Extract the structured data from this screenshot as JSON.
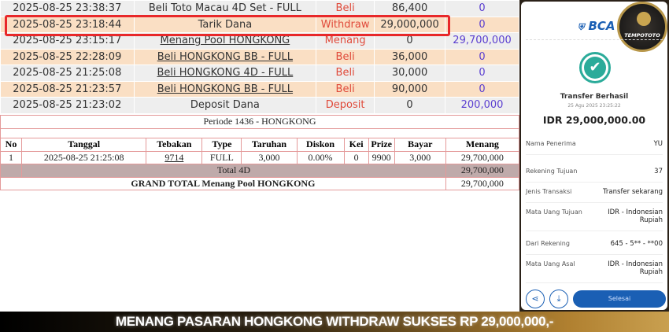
{
  "transactions": [
    {
      "date": "2025-08-25 23:38:37",
      "desc": "Beli Toto Macau 4D Set - FULL",
      "type": "Beli",
      "debit": "86,400",
      "credit": "0",
      "link": true,
      "underline": false
    },
    {
      "date": "2025-08-25 23:18:44",
      "desc": "Tarik Dana",
      "type": "Withdraw",
      "debit": "29,000,000",
      "credit": "0",
      "link": false
    },
    {
      "date": "2025-08-25 23:15:17",
      "desc": "Menang Pool HONGKONG",
      "type": "Menang",
      "debit": "0",
      "credit": "29,700,000",
      "link": true,
      "underline": true
    },
    {
      "date": "2025-08-25 22:28:09",
      "desc": "Beli HONGKONG BB - FULL",
      "type": "Beli",
      "debit": "36,000",
      "credit": "0",
      "link": true,
      "underline": true
    },
    {
      "date": "2025-08-25 21:25:08",
      "desc": "Beli HONGKONG 4D - FULL",
      "type": "Beli",
      "debit": "30,000",
      "credit": "0",
      "link": true,
      "underline": true
    },
    {
      "date": "2025-08-25 21:23:57",
      "desc": "Beli HONGKONG BB - FULL",
      "type": "Beli",
      "debit": "90,000",
      "credit": "0",
      "link": true,
      "underline": true
    },
    {
      "date": "2025-08-25 21:23:02",
      "desc": "Deposit Dana",
      "type": "Deposit",
      "debit": "0",
      "credit": "200,000",
      "link": false
    }
  ],
  "detail": {
    "periode": "Periode 1436 - HONGKONG",
    "headers": [
      "No",
      "Tanggal",
      "Tebakan",
      "Type",
      "Taruhan",
      "Diskon",
      "Kei",
      "Prize",
      "Bayar",
      "Menang"
    ],
    "row": [
      "1",
      "2025-08-25 21:25:08",
      "9714",
      "FULL",
      "3,000",
      "0.00%",
      "0",
      "9900",
      "3,000",
      "29,700,000"
    ],
    "total_label": "Total 4D",
    "total_value": "29,700,000",
    "grand_label": "GRAND TOTAL  Menang Pool HONGKONG",
    "grand_value": "29,700,000"
  },
  "receipt": {
    "bank": "BCA",
    "logo": "TEMPOTOTO",
    "status": "Transfer Berhasil",
    "datetime": "25 Agu 2025 23:25:22",
    "amount": "IDR 29,000,000.00",
    "fields": [
      {
        "label": "Nama Penerima",
        "value": "YU"
      },
      {
        "label": "Rekening Tujuan",
        "value": "37"
      },
      {
        "label": "Jenis Transaksi",
        "value": "Transfer sekarang"
      },
      {
        "label": "Mata Uang Tujuan",
        "value": "IDR - Indonesian Rupiah"
      },
      {
        "label": "Dari Rekening",
        "value": "645 - 5** - **00"
      },
      {
        "label": "Mata Uang Asal",
        "value": "IDR - Indonesian Rupiah"
      }
    ],
    "done_label": "Selesai",
    "accent": "#1a5fb4",
    "check_color": "#2bab9a"
  },
  "banner": "MENANG PASARAN HONGKONG WITHDRAW SUKSES RP 29,000,000,-"
}
